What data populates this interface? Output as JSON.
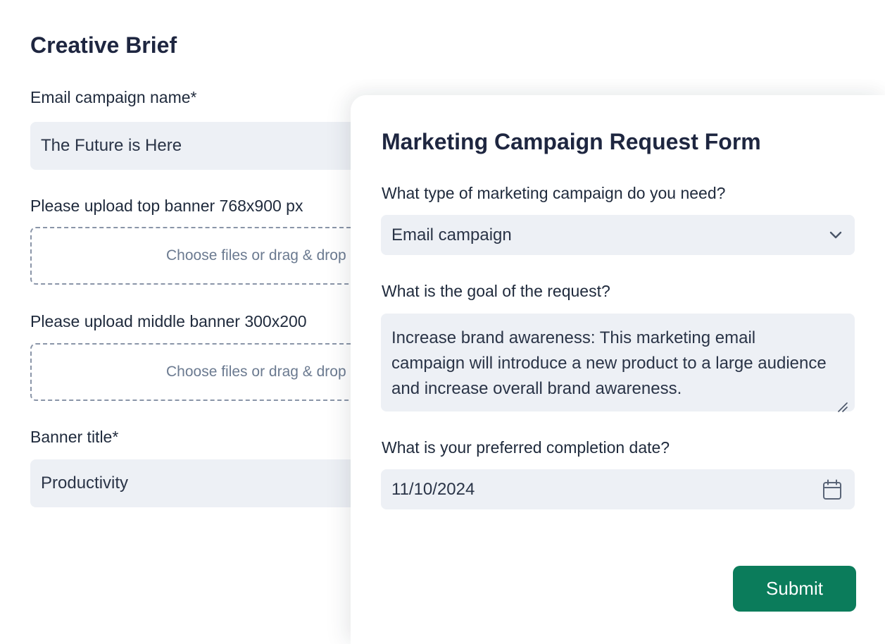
{
  "brief": {
    "title": "Creative Brief",
    "campaign_name_label": "Email campaign name*",
    "campaign_name_value": "The Future is Here",
    "top_banner_label": "Please upload top banner 768x900 px",
    "top_banner_drop": "Choose files or drag & drop",
    "middle_banner_label": "Please upload middle banner 300x200",
    "middle_banner_drop": "Choose files or drag & drop",
    "banner_title_label": "Banner title*",
    "banner_title_value": "Productivity"
  },
  "form": {
    "title": "Marketing Campaign Request Form",
    "q_type": "What type of marketing campaign do you need?",
    "type_value": "Email campaign",
    "q_goal": "What is the goal of the request?",
    "goal_value": "Increase brand awareness: This marketing email campaign will introduce a new product to a large audience and increase overall brand awareness.",
    "q_date": "What is your preferred completion date?",
    "date_value": "11/10/2024",
    "submit_label": "Submit"
  },
  "icons": {
    "type_select": "chevron-down-icon",
    "date": "calendar-icon",
    "textarea_resize": "resize-handle-icon"
  },
  "colors": {
    "accent": "#0b7c5b",
    "input_bg": "#edf0f5",
    "heading": "#1e2640"
  }
}
